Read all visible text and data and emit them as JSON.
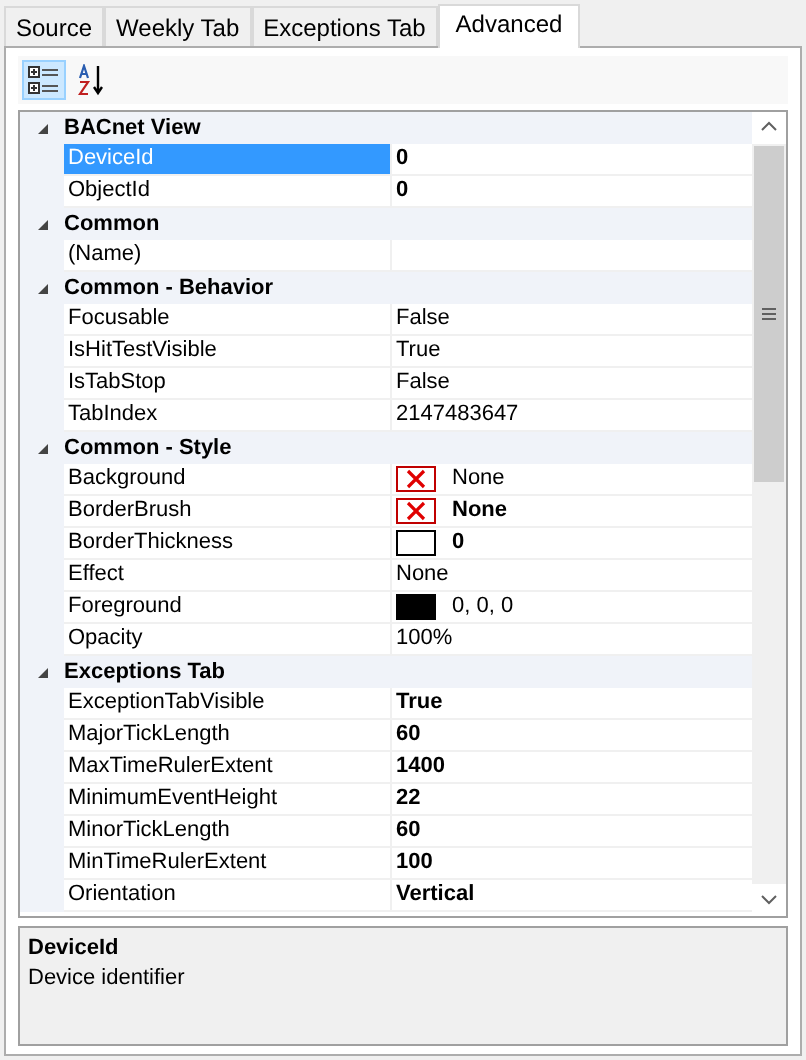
{
  "tabs": [
    {
      "label": "Source",
      "selected": false
    },
    {
      "label": "Weekly Tab",
      "selected": false
    },
    {
      "label": "Exceptions Tab",
      "selected": false
    },
    {
      "label": "Advanced",
      "selected": true
    }
  ],
  "toolbar": {
    "categorized_selected": true,
    "alphabetical_selected": false
  },
  "categories": [
    {
      "name": "BACnet View",
      "expanded": true,
      "properties": [
        {
          "kind": "plain",
          "name": "DeviceId",
          "value": "0",
          "bold": true,
          "selected": true
        },
        {
          "kind": "plain",
          "name": "ObjectId",
          "value": "0",
          "bold": true,
          "selected": false
        }
      ]
    },
    {
      "name": "Common",
      "expanded": true,
      "properties": [
        {
          "kind": "plain",
          "name": "(Name)",
          "selected": false
        }
      ]
    },
    {
      "name": "Common - Behavior",
      "expanded": true,
      "properties": [
        {
          "kind": "plain",
          "name": "Focusable",
          "value": "False",
          "bold": false,
          "selected": false
        },
        {
          "kind": "plain",
          "name": "IsHitTestVisible",
          "value": "True",
          "bold": false,
          "selected": false
        },
        {
          "kind": "plain",
          "name": "IsTabStop",
          "value": "False",
          "bold": false,
          "selected": false
        },
        {
          "kind": "plain",
          "name": "TabIndex",
          "value": "2147483647",
          "bold": false,
          "selected": false
        }
      ]
    },
    {
      "name": "Common - Style",
      "expanded": true,
      "properties": [
        {
          "kind": "cross",
          "name": "Background",
          "value": "None",
          "bold": false,
          "selected": false
        },
        {
          "kind": "cross",
          "name": "BorderBrush",
          "value": "None",
          "bold": true,
          "selected": false
        },
        {
          "kind": "empty",
          "name": "BorderThickness",
          "value": "0",
          "bold": true,
          "selected": false
        },
        {
          "kind": "plain",
          "name": "Effect",
          "value": "None",
          "bold": false,
          "selected": false
        },
        {
          "kind": "color",
          "name": "Foreground",
          "value": "0, 0, 0",
          "bold": false,
          "selected": false,
          "color": "#000000"
        },
        {
          "kind": "plain",
          "name": "Opacity",
          "value": "100%",
          "bold": false,
          "selected": false
        }
      ]
    },
    {
      "name": "Exceptions Tab",
      "expanded": true,
      "properties": [
        {
          "kind": "plain",
          "name": "ExceptionTabVisible",
          "value": "True",
          "bold": true,
          "selected": false
        },
        {
          "kind": "plain",
          "name": "MajorTickLength",
          "value": "60",
          "bold": true,
          "selected": false
        },
        {
          "kind": "plain",
          "name": "MaxTimeRulerExtent",
          "value": "1400",
          "bold": true,
          "selected": false
        },
        {
          "kind": "plain",
          "name": "MinimumEventHeight",
          "value": "22",
          "bold": true,
          "selected": false
        },
        {
          "kind": "plain",
          "name": "MinorTickLength",
          "value": "60",
          "bold": true,
          "selected": false
        },
        {
          "kind": "plain",
          "name": "MinTimeRulerExtent",
          "value": "100",
          "bold": true,
          "selected": false
        },
        {
          "kind": "plain",
          "name": "Orientation",
          "value": "Vertical",
          "bold": true,
          "selected": false
        }
      ]
    }
  ],
  "description": {
    "title": "DeviceId",
    "text": "Device identifier"
  }
}
